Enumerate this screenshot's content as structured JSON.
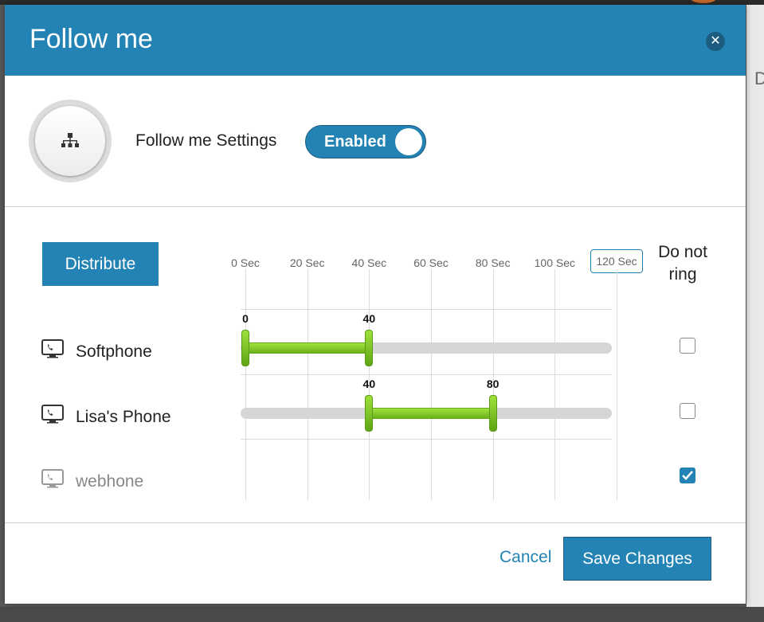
{
  "modal": {
    "title": "Follow me",
    "close_icon": "close-icon"
  },
  "settings": {
    "label": "Follow me Settings",
    "toggle_label": "Enabled",
    "toggle_on": true,
    "avatar_icon": "org-chart-icon"
  },
  "distribute_label": "Distribute",
  "scale": {
    "labels": [
      "0 Sec",
      "20 Sec",
      "40 Sec",
      "60 Sec",
      "80 Sec",
      "100 Sec",
      "120 Sec"
    ],
    "selected_label": "120 Sec",
    "max_seconds": 120
  },
  "do_not_ring_label_1": "Do not",
  "do_not_ring_label_2": "ring",
  "devices": [
    {
      "name": "Softphone",
      "icon": "phone-screen-icon",
      "start": 0,
      "end": 40,
      "start_label": "0",
      "end_label": "40",
      "do_not_ring": false,
      "has_range": true
    },
    {
      "name": "Lisa's Phone",
      "icon": "phone-screen-icon",
      "start": 40,
      "end": 80,
      "start_label": "40",
      "end_label": "80",
      "do_not_ring": false,
      "has_range": true
    },
    {
      "name": "webhone",
      "icon": "phone-screen-icon",
      "do_not_ring": true,
      "has_range": false
    }
  ],
  "footer": {
    "cancel_label": "Cancel",
    "save_label": "Save Changes"
  },
  "colors": {
    "accent": "#2383b4",
    "range_green": "#7cc52a",
    "track_gray": "#d6d6d6"
  }
}
